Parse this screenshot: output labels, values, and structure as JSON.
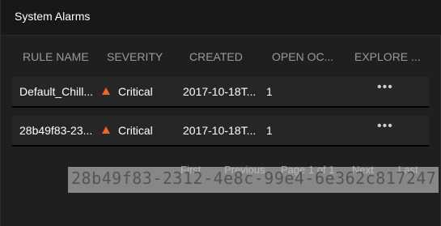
{
  "panel": {
    "title": "System Alarms"
  },
  "table": {
    "columns": [
      "RULE NAME",
      "SEVERITY",
      "CREATED",
      "OPEN OC...",
      "EXPLORE ..."
    ],
    "rows": [
      {
        "rule_name": "Default_Chill...",
        "severity": "Critical",
        "created": "2017-10-18T...",
        "open_occurrences": "1",
        "explore": "•••"
      },
      {
        "rule_name": "28b49f83-23...",
        "severity": "Critical",
        "created": "2017-10-18T...",
        "open_occurrences": "1",
        "explore": "•••"
      }
    ]
  },
  "pagination": {
    "first": "First",
    "previous": "Previous",
    "page_info": "Page 1 of 1",
    "next": "Next",
    "last": "Last"
  },
  "tooltip": {
    "text": "28b49f83-2312-4e8c-99e4-6e362c817247"
  },
  "colors": {
    "critical": "#f26522",
    "background": "#1f1f1f",
    "header_text": "#9a9a9a"
  }
}
